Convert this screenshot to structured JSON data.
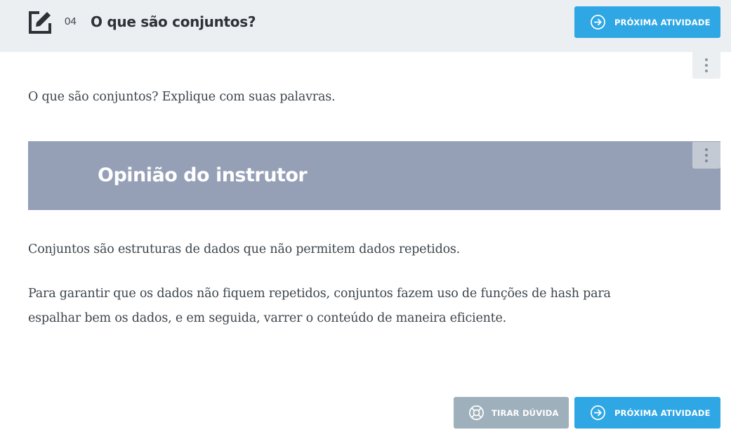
{
  "header": {
    "task_number": "04",
    "task_title": "O que são conjuntos?",
    "next_button_label": "PRÓXIMA ATIVIDADE"
  },
  "question": {
    "text": "O que são conjuntos? Explique com suas palavras."
  },
  "opinion": {
    "title": "Opinião do instrutor",
    "paragraphs": [
      "Conjuntos são estruturas de dados que não permitem dados repetidos.",
      "Para garantir que os dados não fiquem repetidos, conjuntos fazem uso de funções de hash para espalhar bem os dados, e em seguida, varrer o conteúdo de maneira eficiente."
    ]
  },
  "footer": {
    "help_button_label": "TIRAR DÚVIDA",
    "next_button_label": "PRÓXIMA ATIVIDADE"
  },
  "icons": {
    "task": "edit-icon",
    "next": "arrow-right-circle-icon",
    "help": "lifebuoy-icon",
    "menu": "more-vertical-icon"
  },
  "colors": {
    "primary": "#2fa7e5",
    "help_button": "#9eb0bb",
    "header_bg": "#eceff1",
    "opinion_banner": "#959fb6"
  }
}
